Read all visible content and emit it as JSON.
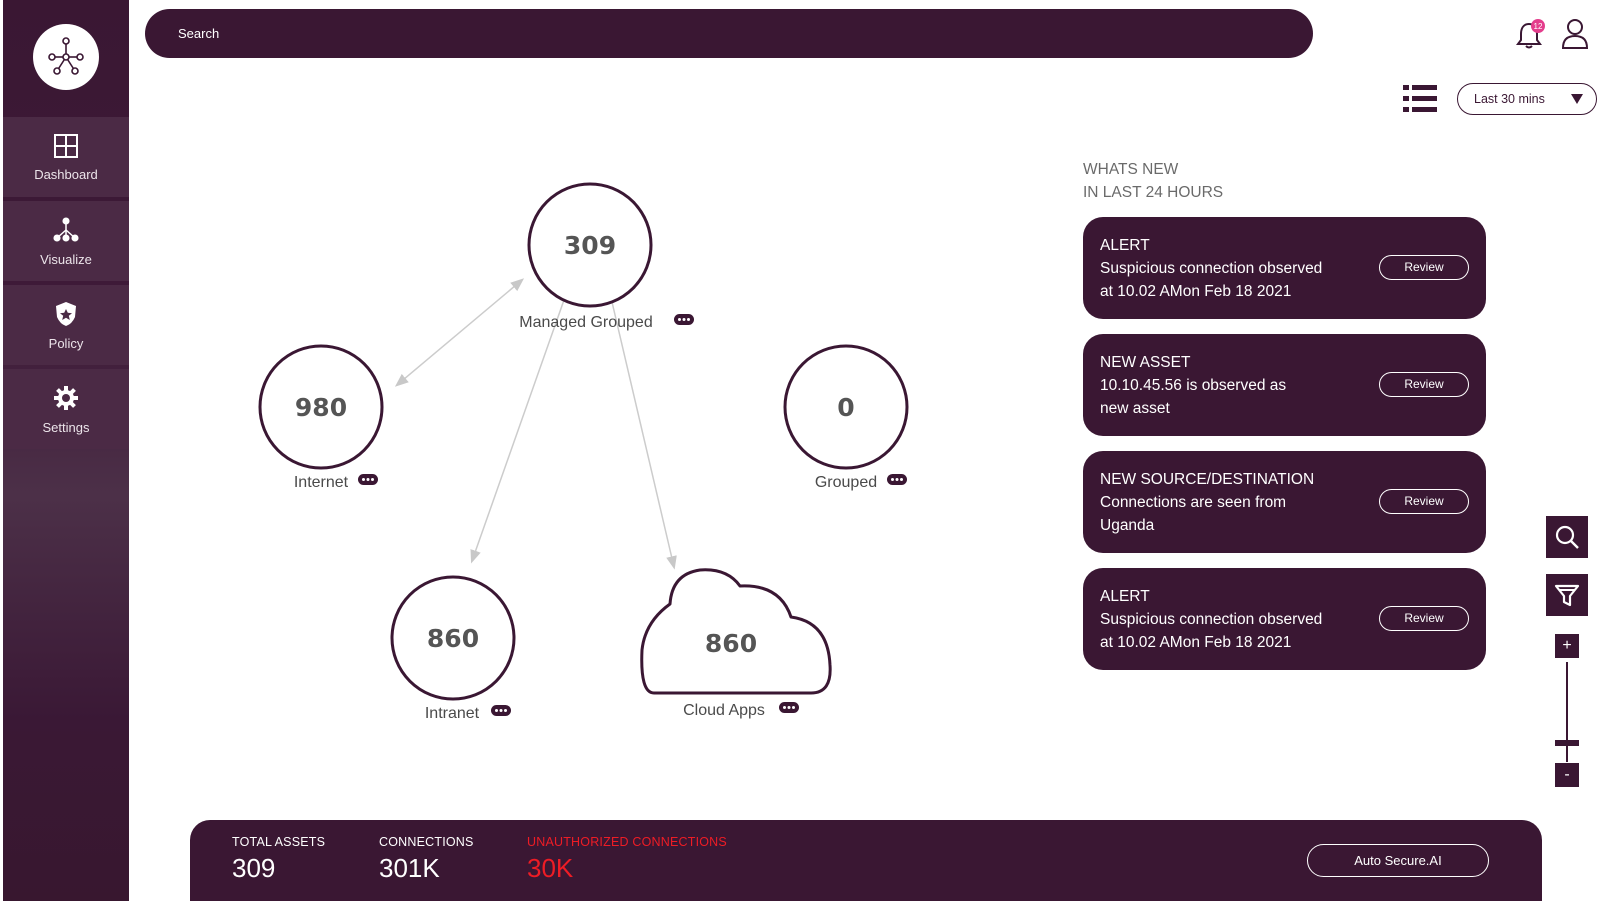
{
  "sidebar": {
    "logo": "network-logo-icon",
    "items": [
      {
        "label": "Dashboard",
        "icon": "grid-icon"
      },
      {
        "label": "Visualize",
        "icon": "network-icon"
      },
      {
        "label": "Policy",
        "icon": "shield-icon"
      },
      {
        "label": "Settings",
        "icon": "gear-icon"
      }
    ]
  },
  "header": {
    "search_placeholder": "Search",
    "notifications_count": "12",
    "time_range": "Last 30 mins"
  },
  "graph": {
    "nodes": [
      {
        "id": "managed",
        "value": "309",
        "label": "Managed Grouped",
        "shape": "circle"
      },
      {
        "id": "internet",
        "value": "980",
        "label": "Internet",
        "shape": "circle"
      },
      {
        "id": "grouped",
        "value": "0",
        "label": "Grouped",
        "shape": "circle"
      },
      {
        "id": "intranet",
        "value": "860",
        "label": "Intranet",
        "shape": "circle"
      },
      {
        "id": "cloud",
        "value": "860",
        "label": "Cloud Apps",
        "shape": "cloud"
      }
    ],
    "edges": [
      {
        "from": "managed",
        "to": "internet",
        "bidirectional": true
      },
      {
        "from": "managed",
        "to": "intranet",
        "bidirectional": false
      },
      {
        "from": "managed",
        "to": "cloud",
        "bidirectional": false
      }
    ]
  },
  "whats_new": {
    "title_line1": "WHATS NEW",
    "title_line2": "IN LAST 24 HOURS",
    "cards": [
      {
        "type": "ALERT",
        "line1": "Suspicious connection observed",
        "line2": "at 10.02 AMon Feb 18 2021",
        "button": "Review"
      },
      {
        "type": "NEW ASSET",
        "line1": "10.10.45.56 is observed as",
        "line2": "new asset",
        "button": "Review"
      },
      {
        "type": "NEW SOURCE/DESTINATION",
        "line1": "Connections are seen from",
        "line2": "Uganda",
        "button": "Review"
      },
      {
        "type": "ALERT",
        "line1": "Suspicious connection observed",
        "line2": "at 10.02 AMon Feb 18 2021",
        "button": "Review"
      }
    ]
  },
  "controls": {
    "zoom_in": "+",
    "zoom_out": "-"
  },
  "stats": {
    "total_assets_label": "TOTAL ASSETS",
    "total_assets_value": "309",
    "connections_label": "CONNECTIONS",
    "connections_value": "301K",
    "unauthorized_label": "UNAUTHORIZED CONNECTIONS",
    "unauthorized_value": "30K",
    "auto_button": "Auto Secure.AI"
  },
  "colors": {
    "primary": "#3a1733",
    "alert_red": "#ee1c25",
    "badge": "#e43d8c"
  }
}
